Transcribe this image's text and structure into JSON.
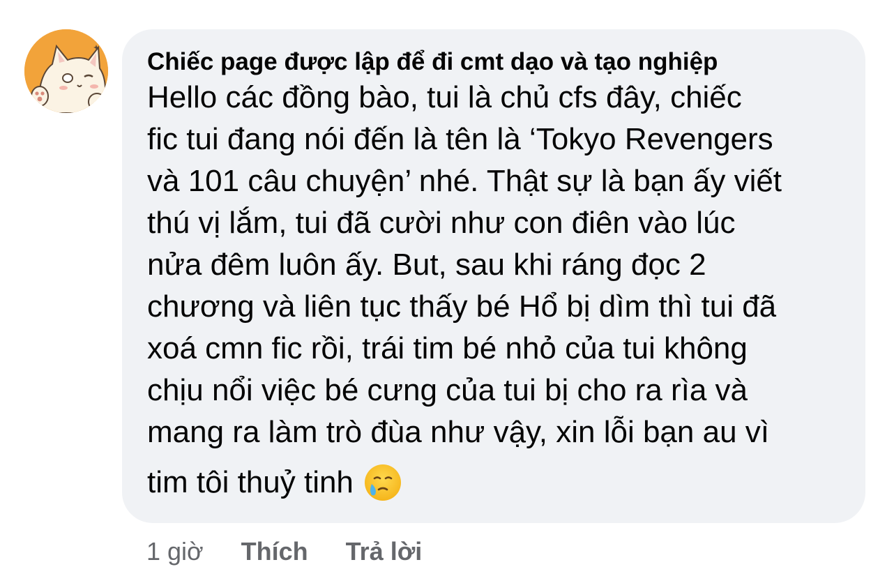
{
  "comment": {
    "author": "Chiếc page được lập để đi cmt dạo và tạo nghiệp",
    "lines": [
      "Hello các đồng bào, tui là chủ cfs đây, chiếc",
      "fic tui đang nói đến là tên là ‘Tokyo Revengers",
      "và 101 câu chuyện’ nhé. Thật sự là bạn ấy viết",
      "thú vị lắm, tui đã cười như con điên vào lúc",
      "nửa đêm luôn ấy. But, sau khi ráng đọc 2",
      "chương và liên tục thấy bé Hổ bị dìm thì tui đã",
      "xoá cmn fic rồi, trái tim bé nhỏ của tui không",
      "chịu nổi việc bé cưng của tui bị cho ra rìa và",
      "mang ra làm trò đùa như vậy, xin lỗi bạn au vì",
      "tim tôi thuỷ tinh"
    ],
    "emoji": "face-holding-back-tears-icon",
    "bubble_color": "#f0f2f5",
    "avatar_color": "#f2a33a"
  },
  "actions": {
    "time": "1 giờ",
    "like_label": "Thích",
    "reply_label": "Trả lời",
    "color": "#65676b"
  }
}
